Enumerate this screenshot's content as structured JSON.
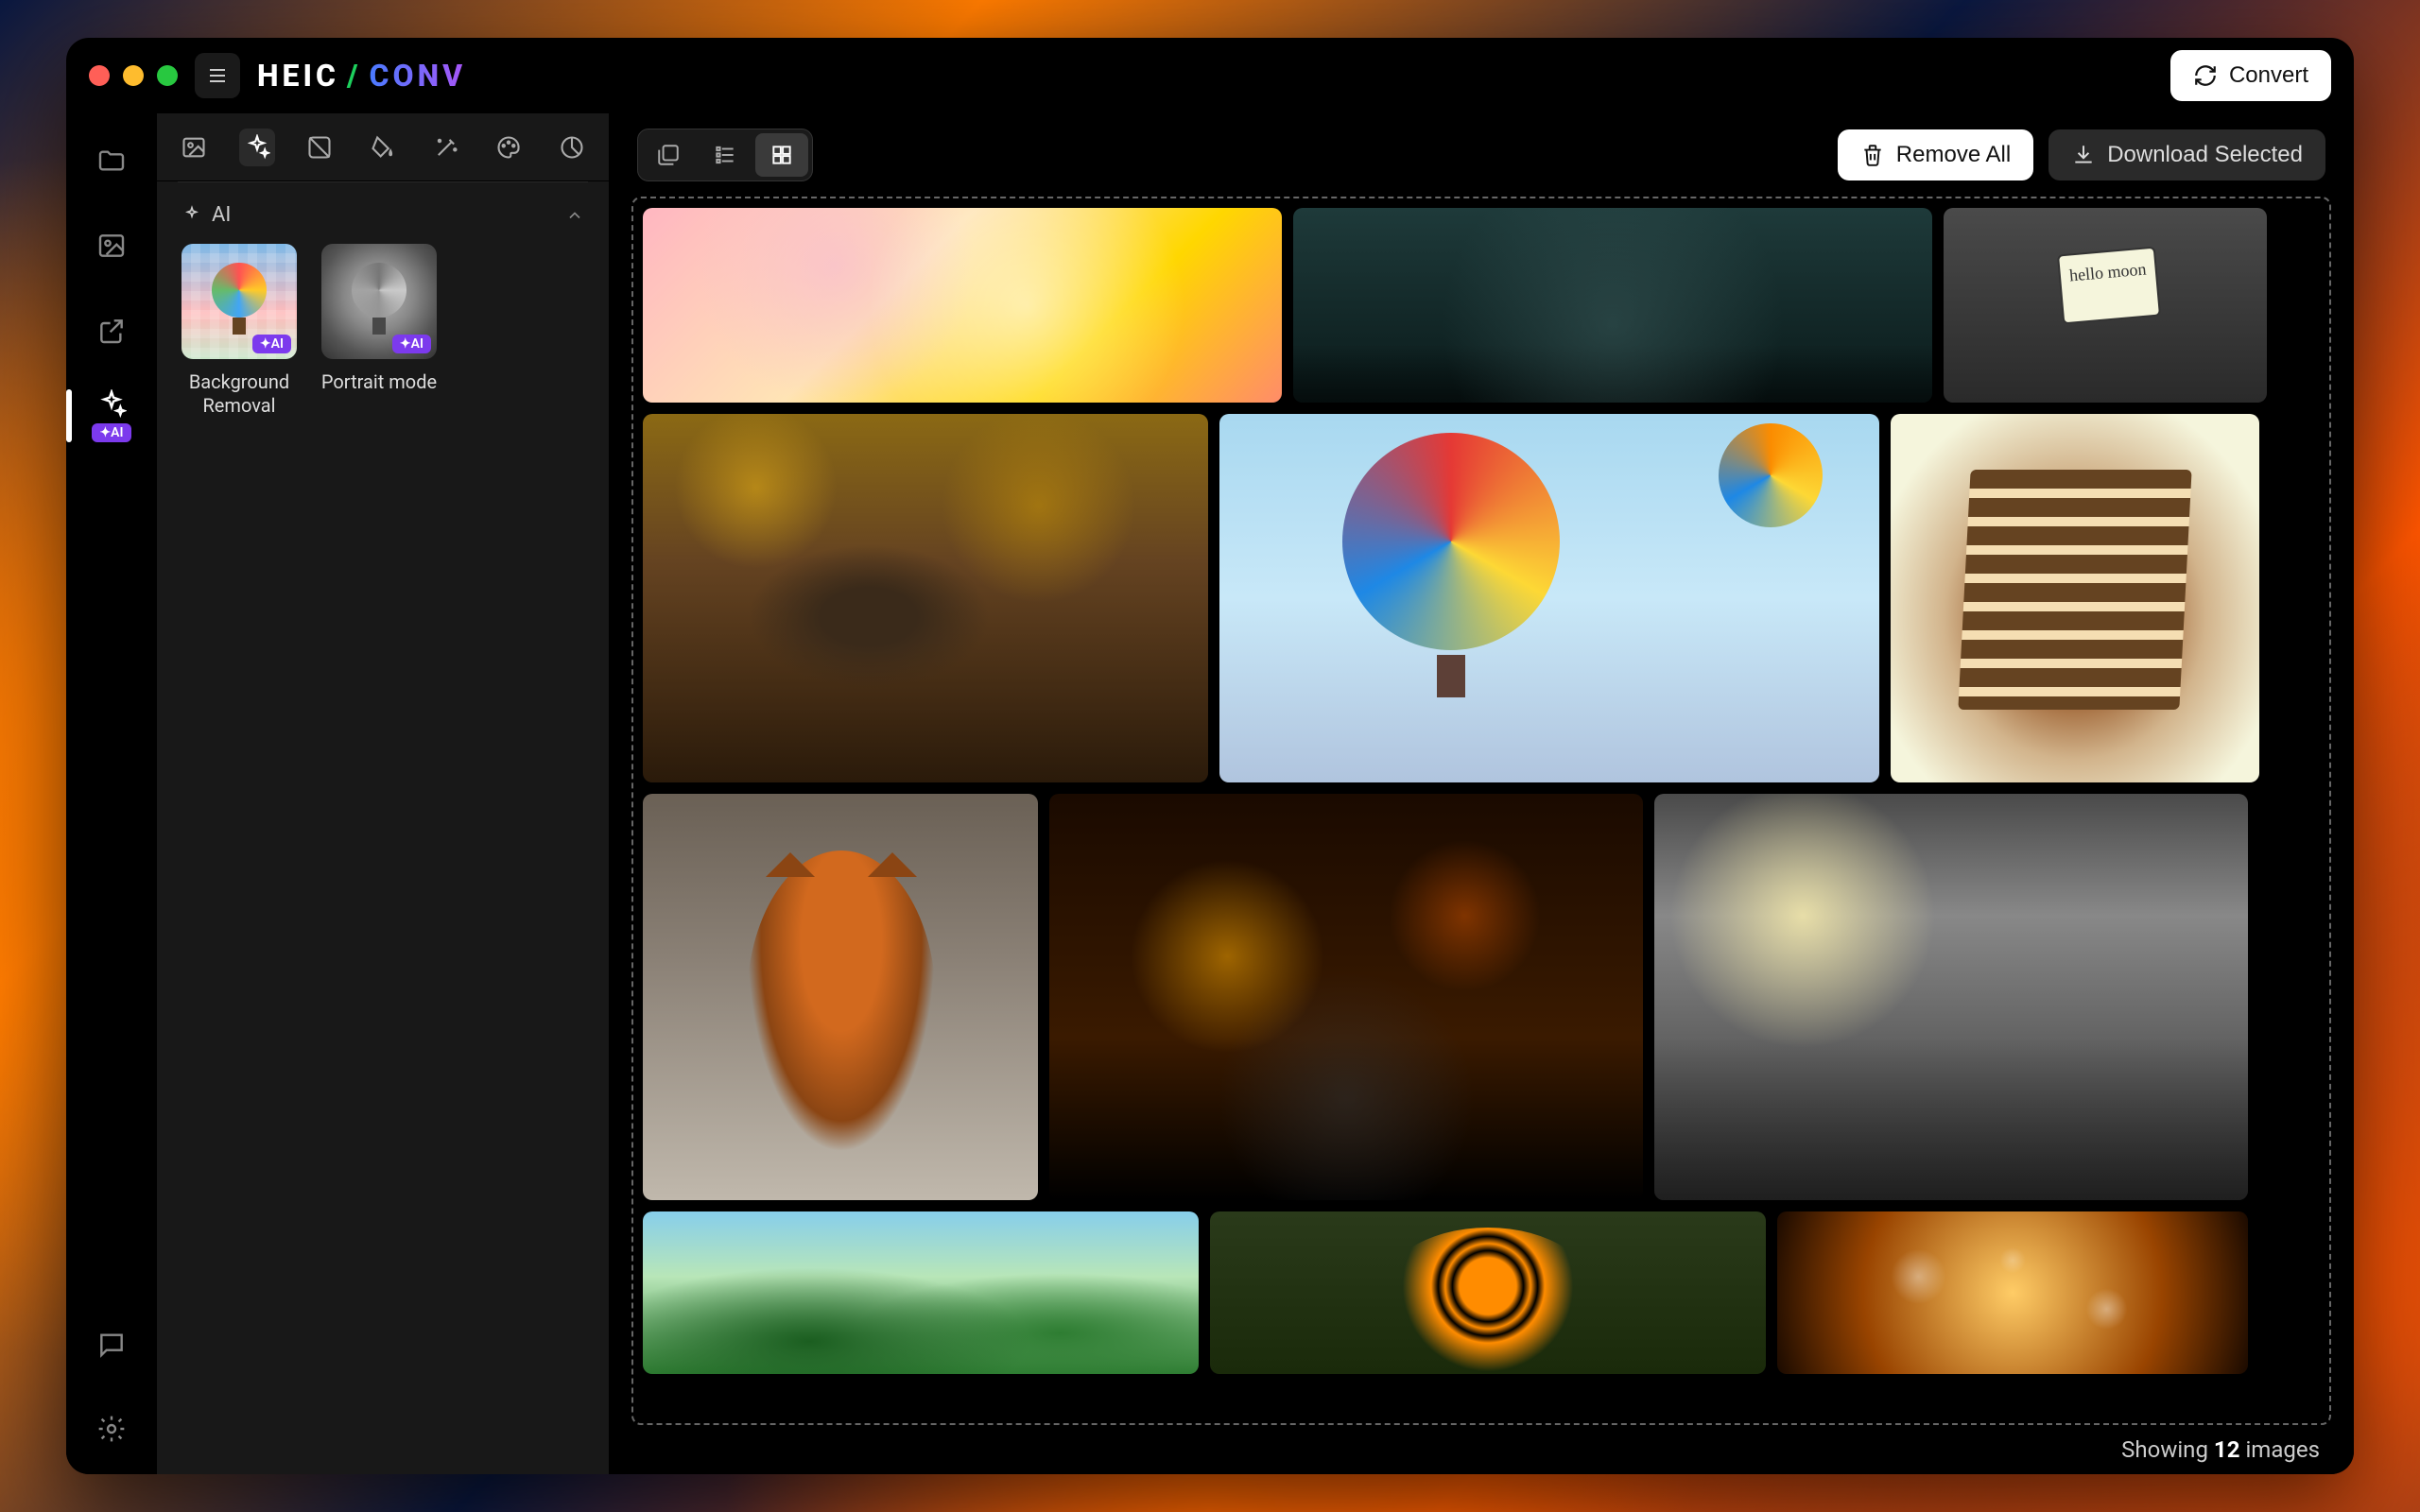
{
  "app": {
    "logo_heic": "HEIC",
    "logo_slash": "/",
    "logo_conv": "CONV"
  },
  "header": {
    "convert_label": "Convert"
  },
  "rail": {
    "ai_badge": "✦AI"
  },
  "panel": {
    "section_title": "AI",
    "cards": [
      {
        "label": "Background Removal",
        "badge": "✦AI"
      },
      {
        "label": "Portrait mode",
        "badge": "✦AI"
      }
    ]
  },
  "main_toolbar": {
    "remove_all_label": "Remove All",
    "download_selected_label": "Download Selected"
  },
  "status": {
    "prefix": "Showing",
    "count": "12",
    "suffix": "images"
  }
}
